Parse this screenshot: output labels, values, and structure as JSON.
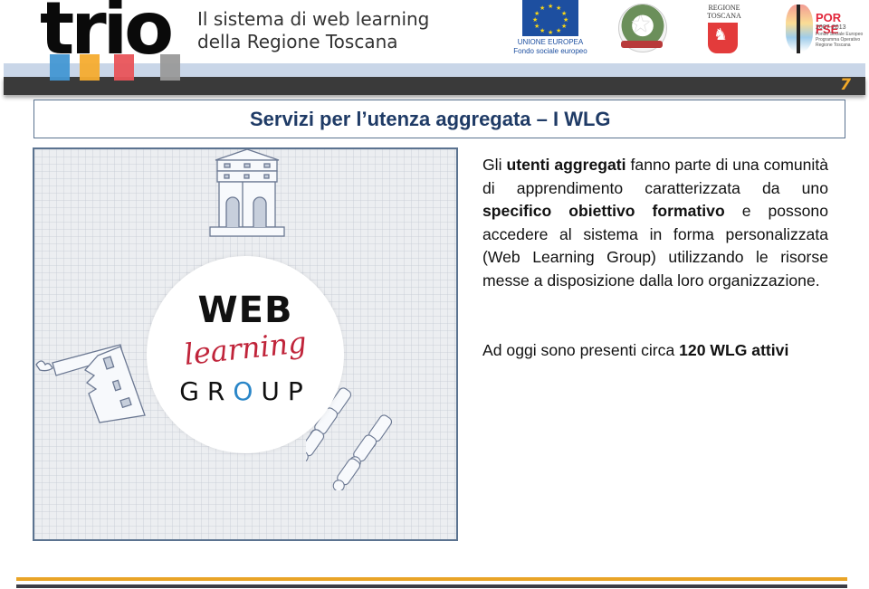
{
  "header": {
    "logo_text": "trio",
    "tagline_line1": "Il sistema di web learning",
    "tagline_line2": "della Regione Toscana",
    "slide_number": "7",
    "logos": {
      "eu_line1": "UNIONE EUROPEA",
      "eu_line2": "Fondo sociale europeo",
      "italy_emblem": "Repubblica Italiana emblem",
      "toscana_line1": "REGIONE",
      "toscana_line2": "TOSCANA",
      "porfse_title": "POR FSE",
      "porfse_years": "2007-2013",
      "porfse_sub": "Fondo Sociale Europeo Programma Operativo Regione Toscana"
    }
  },
  "slide": {
    "title": "Servizi per l’utenza aggregata – I WLG",
    "image": {
      "web": "WEB",
      "learning": "learning",
      "group_g": "G",
      "group_r": "R",
      "group_o": "O",
      "group_up": "UP",
      "description": "Web Learning Group illustration with building, factory and people sketches"
    },
    "paragraph": {
      "p1": "Gli ",
      "b1": "utenti aggregati",
      "p2": " fanno parte di una comunità di apprendimento caratterizzata da uno ",
      "b2": "specifico obiettivo formativo",
      "p3": " e possono  accedere al sistema in forma personalizzata (Web Learning Group) utilizzando le risorse messe a disposizione dalla loro organizzazione."
    },
    "stat": {
      "prefix": "Ad oggi sono presenti circa ",
      "bold": "120 WLG attivi"
    }
  },
  "colors": {
    "title": "#1f3b66",
    "accent_orange": "#e9a427",
    "dark_band": "#3a3a3a",
    "blue_band": "#c9d6e8",
    "wlg_red": "#c0243a"
  }
}
